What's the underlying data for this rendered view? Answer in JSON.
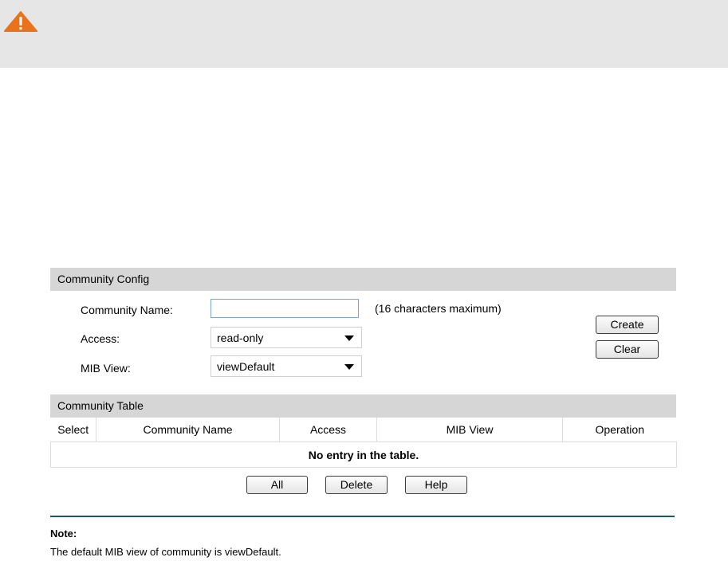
{
  "banner": {
    "icon": "warning-icon"
  },
  "community_config": {
    "header": "Community Config",
    "name_label": "Community Name:",
    "name_value": "",
    "name_hint": "(16 characters maximum)",
    "access_label": "Access:",
    "access_value": "read-only",
    "mib_label": "MIB View:",
    "mib_value": "viewDefault",
    "create_label": "Create",
    "clear_label": "Clear"
  },
  "community_table": {
    "header": "Community Table",
    "columns": [
      "Select",
      "Community Name",
      "Access",
      "MIB View",
      "Operation"
    ],
    "empty_message": "No entry in the table."
  },
  "table_actions": {
    "all_label": "All",
    "delete_label": "Delete",
    "help_label": "Help"
  },
  "note": {
    "title": "Note:",
    "text": "The default MIB view of community is viewDefault."
  },
  "colors": {
    "banner_bg": "#e6e6e6",
    "header_bg": "#d6d6d6",
    "warning": "#e8731c",
    "note_rule": "#1f5a63"
  }
}
